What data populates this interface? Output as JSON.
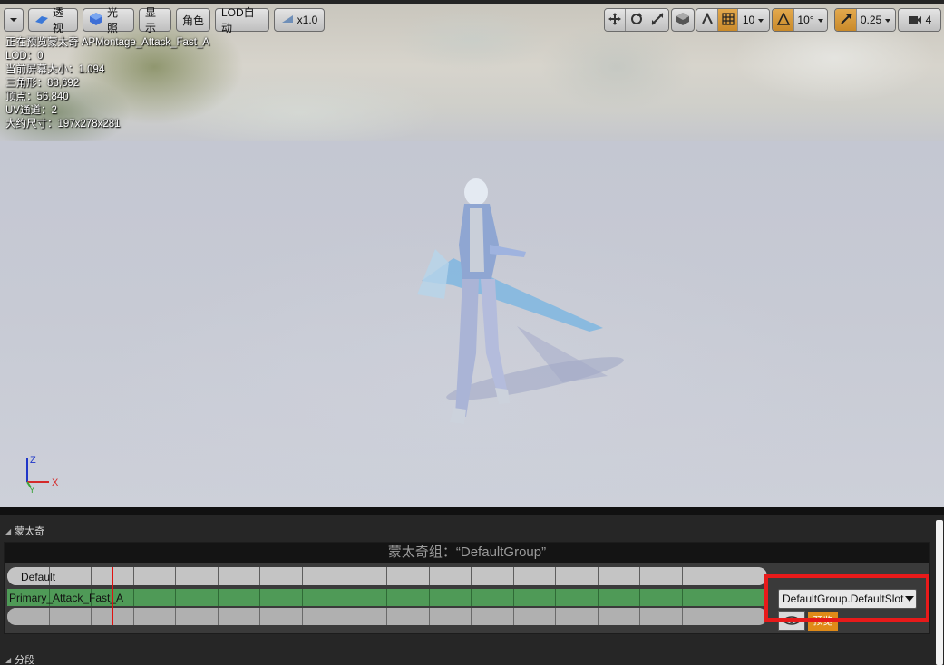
{
  "toolbar": {
    "perspective_label": "透视",
    "lit_label": "光照",
    "show_label": "显示",
    "character_label": "角色",
    "lod_label": "LOD自动",
    "speed_label": "x1.0",
    "grid_snap_value": "10",
    "rotation_snap_value": "10°",
    "scale_snap_value": "0.25",
    "camera_speed_value": "4"
  },
  "stats": {
    "line1": "正在预览蒙太奇 APMontage_Attack_Fast_A",
    "line2": "LOD：0",
    "line3": "当前屏幕大小：1.094",
    "line4": "三角形：83,692",
    "line5": "顶点：56,840",
    "line6": "UV通道：2",
    "line7": "大约尺寸：197x278x281"
  },
  "axes": {
    "z": "Z",
    "y": "Y",
    "x": "X"
  },
  "montage_panel": {
    "section_label": "蒙太奇",
    "group_title": "蒙太奇组：“DefaultGroup”",
    "default_track_label": "Default",
    "slot_segment_label": "Primary_Attack_Fast_A",
    "slot_dropdown_value": "DefaultGroup.DefaultSlot",
    "preview_button": "预览",
    "next_section_label": "分段"
  },
  "colors": {
    "accent_orange": "#e08a18",
    "slot_green": "#4f9a57",
    "highlight_red": "#e81a1a",
    "playhead_red": "#e01010"
  }
}
